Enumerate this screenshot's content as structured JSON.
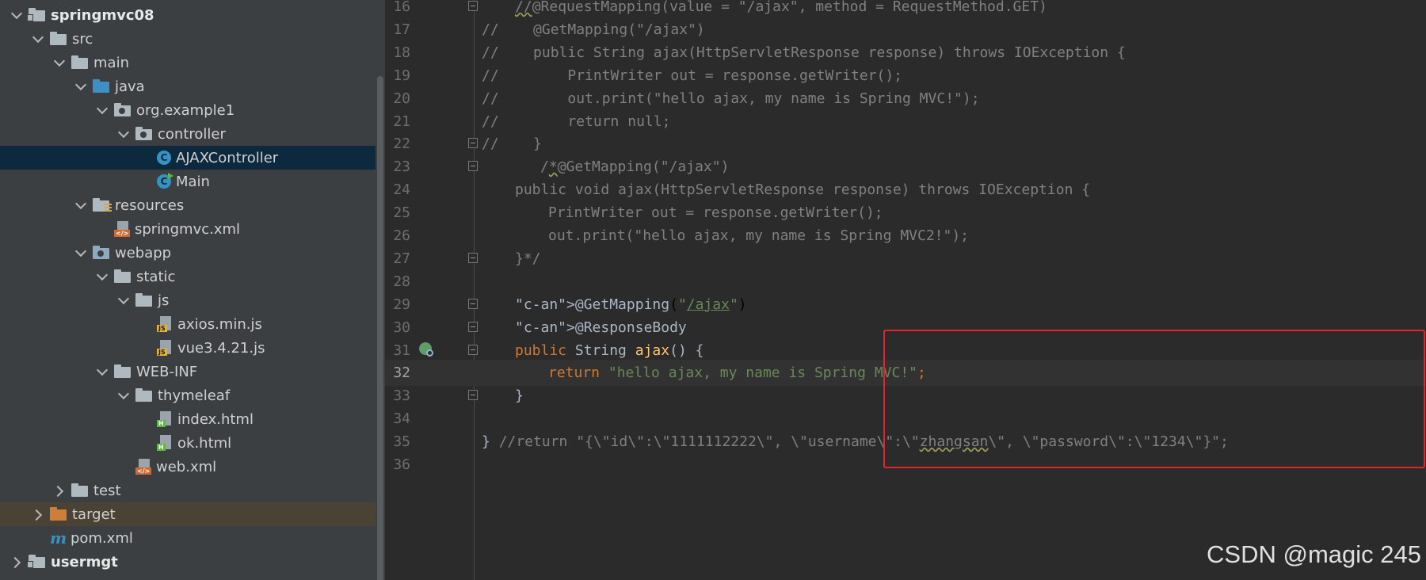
{
  "project_tree": {
    "items": [
      {
        "label": "springmvc08",
        "icon": "module-folder-icon",
        "bold": true,
        "open": true
      },
      {
        "label": "src",
        "icon": "folder-icon",
        "open": true
      },
      {
        "label": "main",
        "icon": "folder-icon",
        "open": true
      },
      {
        "label": "java",
        "icon": "source-folder-icon",
        "open": true
      },
      {
        "label": "org.example1",
        "icon": "package-icon",
        "open": true
      },
      {
        "label": "controller",
        "icon": "package-icon",
        "open": true
      },
      {
        "label": "AJAXController",
        "icon": "java-class-icon",
        "selected": true
      },
      {
        "label": "Main",
        "icon": "main-class-icon"
      },
      {
        "label": "resources",
        "icon": "resources-folder-icon",
        "open": true
      },
      {
        "label": "springmvc.xml",
        "icon": "xml-file-icon"
      },
      {
        "label": "webapp",
        "icon": "web-folder-icon",
        "open": true
      },
      {
        "label": "static",
        "icon": "folder-icon",
        "open": true
      },
      {
        "label": "js",
        "icon": "folder-icon",
        "open": true
      },
      {
        "label": "axios.min.js",
        "icon": "js-file-icon"
      },
      {
        "label": "vue3.4.21.js",
        "icon": "js-file-icon"
      },
      {
        "label": "WEB-INF",
        "icon": "folder-icon",
        "open": true
      },
      {
        "label": "thymeleaf",
        "icon": "folder-icon",
        "open": true
      },
      {
        "label": "index.html",
        "icon": "html-file-icon"
      },
      {
        "label": "ok.html",
        "icon": "html-file-icon"
      },
      {
        "label": "web.xml",
        "icon": "xml-file-icon"
      },
      {
        "label": "test",
        "icon": "folder-icon",
        "open": false
      },
      {
        "label": "target",
        "icon": "excluded-folder-icon",
        "open": false,
        "excluded": true
      },
      {
        "label": "pom.xml",
        "icon": "maven-icon"
      },
      {
        "label": "usermgt",
        "icon": "module-folder-icon",
        "bold": true,
        "open": false
      }
    ]
  },
  "editor": {
    "lines": [
      {
        "n": "16",
        "t": "//@RequestMapping(value = \"/ajax\", method = RequestMethod.GET)"
      },
      {
        "n": "17",
        "t": "//    @GetMapping(\"/ajax\")"
      },
      {
        "n": "18",
        "t": "//    public String ajax(HttpServletResponse response) throws IOException {"
      },
      {
        "n": "19",
        "t": "//        PrintWriter out = response.getWriter();"
      },
      {
        "n": "20",
        "t": "//        out.print(\"hello ajax, my name is Spring MVC!\");"
      },
      {
        "n": "21",
        "t": "//        return null;"
      },
      {
        "n": "22",
        "t": "//    }"
      },
      {
        "n": "23",
        "t": "/*@GetMapping(\"/ajax\")"
      },
      {
        "n": "24",
        "t": "public void ajax(HttpServletResponse response) throws IOException {"
      },
      {
        "n": "25",
        "t": "PrintWriter out = response.getWriter();"
      },
      {
        "n": "26",
        "t": "out.print(\"hello ajax, my name is Spring MVC2!\");"
      },
      {
        "n": "27",
        "t": "}*/"
      },
      {
        "n": "28",
        "t": ""
      },
      {
        "n": "29",
        "t": "@GetMapping(\"/ajax\")"
      },
      {
        "n": "30",
        "t": "@ResponseBody"
      },
      {
        "n": "31",
        "t": "public String ajax() {"
      },
      {
        "n": "32",
        "t": "return \"hello ajax, my name is Spring MVC!\";"
      },
      {
        "n": "33",
        "t": "}"
      },
      {
        "n": "34",
        "t": ""
      },
      {
        "n": "35",
        "t": "} //return \"{\\\"id\\\":\\\"1111112222\\\", \\\"username\\\":\\\"zhangsan\\\", \\\"password\\\":\\\"1234\\\"}\";"
      },
      {
        "n": "36",
        "t": ""
      }
    ]
  },
  "watermark": "CSDN @magic 245"
}
